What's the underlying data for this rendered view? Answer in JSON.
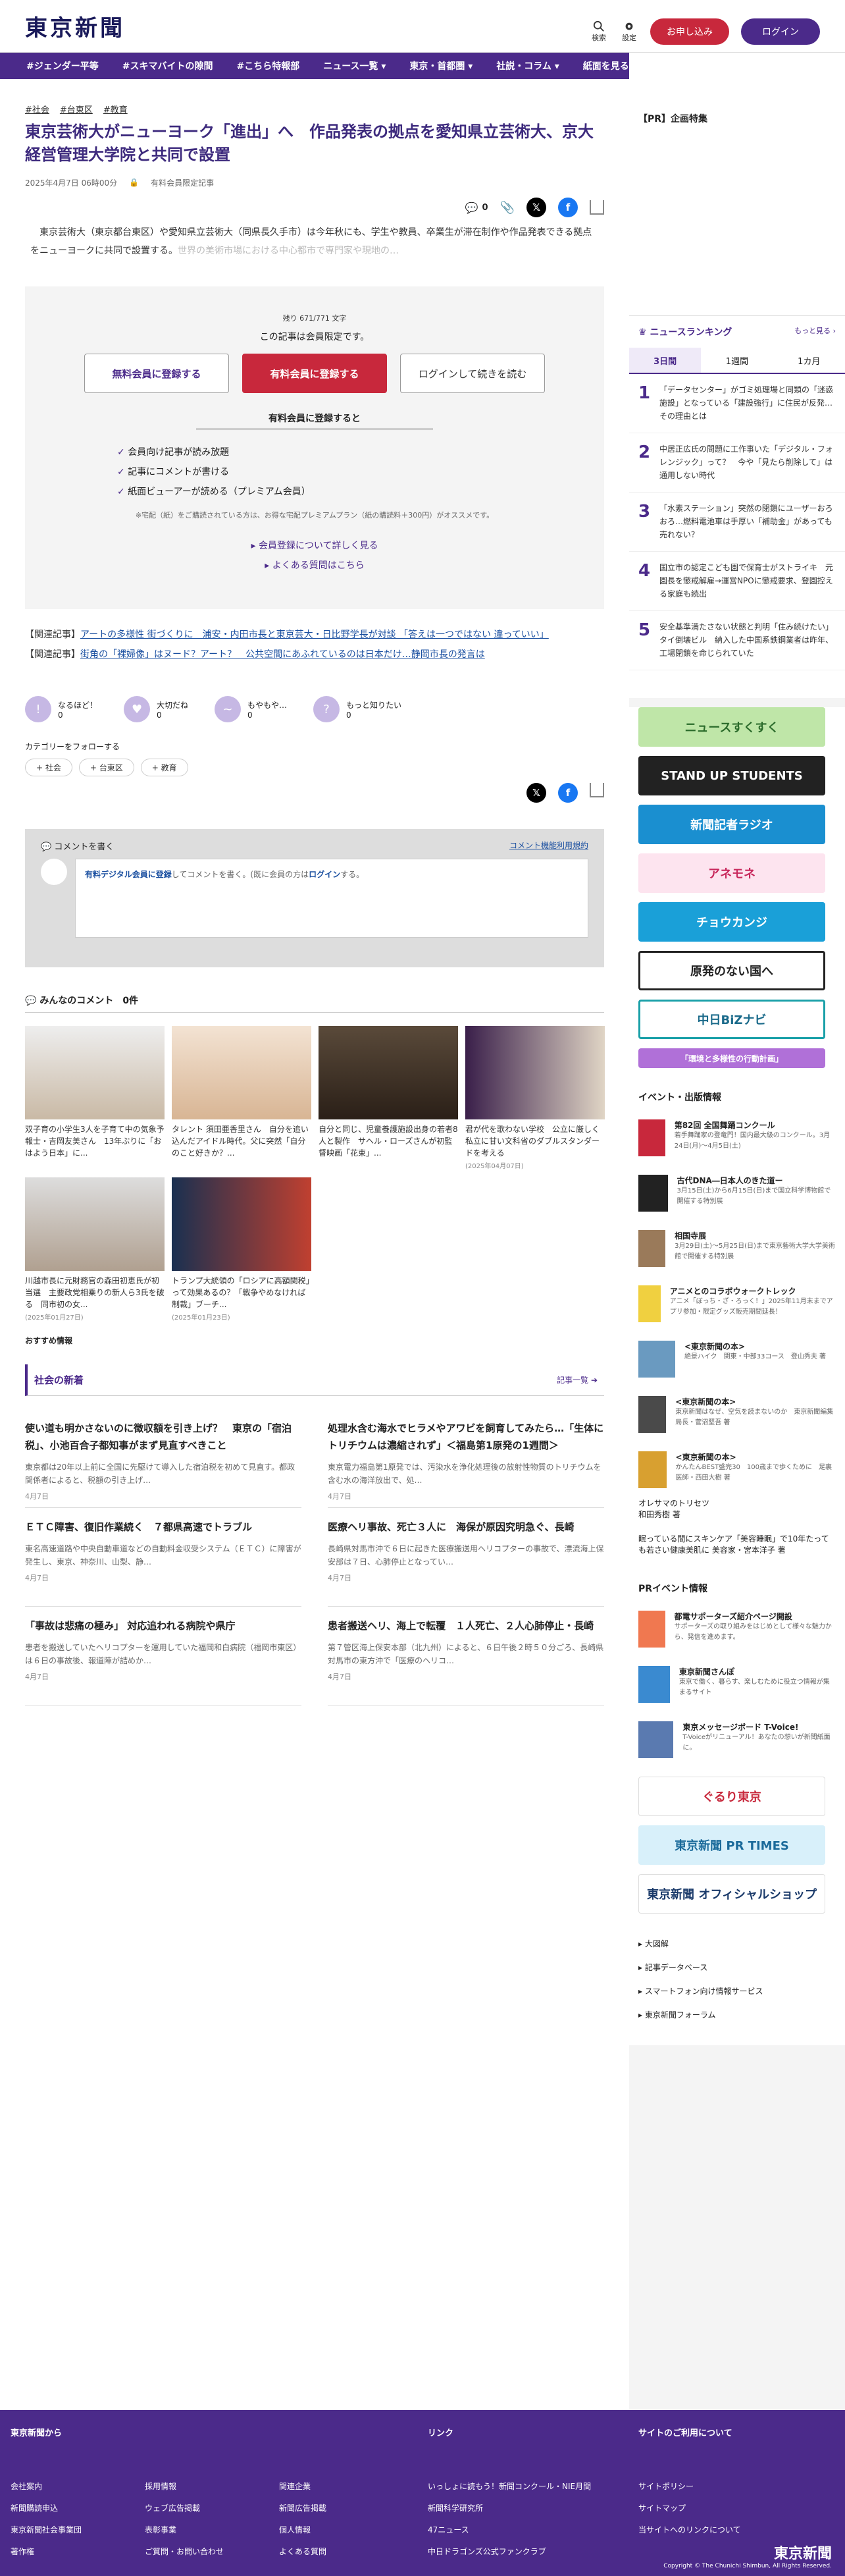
{
  "header": {
    "logo": "東京新聞",
    "search_label": "検索",
    "settings_label": "設定",
    "register_label": "お申し込み",
    "login_label": "ログイン"
  },
  "nav": [
    "#ジェンダー平等",
    "#スキマバイトの隙間",
    "#こちら特報部",
    "ニュース一覧 ▾",
    "東京・首都圏 ▾",
    "社説・コラム ▾",
    "紙面を見る ▾"
  ],
  "article": {
    "tags": [
      "#社会",
      "#台東区",
      "#教育"
    ],
    "title": "東京芸術大がニューヨーク「進出」へ　作品発表の拠点を愛知県立芸術大、京大経営管理大学院と共同で設置",
    "date": "2025年4月7日 06時00分",
    "member_only": "有料会員限定記事",
    "comment_count": "0",
    "lead": "　東京芸術大（東京都台東区）や愛知県立芸術大（同県長久手市）は今年秋にも、学生や教員、卒業生が滞在制作や作品発表できる拠点をニューヨークに共同で設置する。",
    "lead_fade": "世界の美術市場における中心都市で専門家や現地の…"
  },
  "paywall": {
    "remaining": "残り 671/771 文字",
    "notice": "この記事は会員限定です。",
    "btn_free": "無料会員に登録する",
    "btn_paid": "有料会員に登録する",
    "btn_login": "ログインして続きを読む",
    "benefit_title": "有料会員に登録すると",
    "benefits": [
      "会員向け記事が読み放題",
      "記事にコメントが書ける",
      "紙面ビューアーが読める（プレミアム会員）"
    ],
    "note": "※宅配（紙）をご購読されている方は、お得な宅配プレミアムプラン（紙の購読料＋300円）がオススメです。",
    "more": "会員登録について詳しく見る",
    "faq": "よくある質問はこちら"
  },
  "related": [
    {
      "label": "【関連記事】",
      "text": "アートの多様性 街づくりに　浦安・内田市長と東京芸大・日比野学長が対談 「答えは一つではない 違っていい」"
    },
    {
      "label": "【関連記事】",
      "text": "街角の「裸婦像」はヌード？アート？　公共空間にあふれているのは日本だけ…静岡市長の発言は"
    }
  ],
  "reactions": [
    {
      "label": "なるほど！",
      "count": "0"
    },
    {
      "label": "大切だね",
      "count": "0"
    },
    {
      "label": "もやもや…",
      "count": "0"
    },
    {
      "label": "もっと知りたい",
      "count": "0"
    }
  ],
  "follow": {
    "title": "カテゴリーをフォローする",
    "chips": [
      "+ 社会",
      "+ 台東区",
      "+ 教育"
    ]
  },
  "comment": {
    "write": "コメントを書く",
    "rules": "コメント機能利用規約",
    "placeholder_link": "有料デジタル会員に登録",
    "placeholder_rest": "してコメントを書く。(既に会員の方は",
    "placeholder_login": "ログイン",
    "placeholder_end": "する。",
    "all_title": "みんなのコメント",
    "all_count": "0件"
  },
  "thumbs": [
    {
      "cap": "双子育の小学生3人を子育て中の気象予報士・吉岡友美さん　13年ぶりに「おはよう日本」に...",
      "date": ""
    },
    {
      "cap": "タレント 須田亜香里さん　自分を追い込んだアイドル時代。父に突然「自分のこと好きか？...",
      "date": ""
    },
    {
      "cap": "自分と同じ、児童養護施設出身の若者8人と製作　サヘル・ローズさんが初監督映画「花束」...",
      "date": ""
    },
    {
      "cap": "君が代を歌わない学校　公立に厳しく私立に甘い文科省のダブルスタンダードを考える",
      "date": "(2025年04月07日)"
    },
    {
      "cap": "川越市長に元財務官の森田初恵氏が初当選　主要政党相乗りの新人ら3氏を破る　同市初の女...",
      "date": "(2025年01月27日)"
    },
    {
      "cap": "トランプ大統領の「ロシアに高額関税」って効果あるの？「戦争やめなければ制裁」ブーチ...",
      "date": "(2025年01月23日)"
    }
  ],
  "recommend": "おすすめ情報",
  "social": {
    "title": "社会の新着",
    "more": "記事一覧",
    "items": [
      {
        "t": "使い道も明かさないのに徴収額を引き上げ？　東京の「宿泊税」、小池百合子都知事がまず見直すべきこと",
        "b": "東京都は20年以上前に全国に先駆けて導入した宿泊税を初めて見直す。都政関係者によると、税額の引き上げ…",
        "d": "4月7日"
      },
      {
        "t": "処理水含む海水でヒラメやアワビを飼育してみたら…「生体にトリチウムは濃縮されず」＜福島第1原発の1週間＞",
        "b": "東京電力福島第1原発では、汚染水を浄化処理後の放射性物質のトリチウムを含む水の海洋放出で、処…",
        "d": "4月7日"
      },
      {
        "t": "ＥＴＣ障害、復旧作業続く　７都県高速でトラブル",
        "b": "東名高速道路や中央自動車道などの自動料金収受システム（ＥＴＣ）に障害が発生し、東京、神奈川、山梨、静…",
        "d": "4月7日"
      },
      {
        "t": "医療ヘリ事故、死亡３人に　海保が原因究明急ぐ、長崎",
        "b": "長崎県対馬市沖で６日に起きた医療搬送用ヘリコプターの事故で、漂流海上保安部は７日、心肺停止となってい…",
        "d": "4月7日"
      },
      {
        "t": "「事故は悲痛の極み」 対応追われる病院や県庁",
        "b": "患者を搬送していたヘリコプターを運用していた福岡和白病院（福岡市東区）は６日の事故後、報道陣が詰めか…",
        "d": "4月7日"
      },
      {
        "t": "患者搬送ヘリ、海上で転覆　１人死亡、２人心肺停止・長崎",
        "b": "第７管区海上保安本部（北九州）によると、６日午後２時５０分ごろ、長崎県対馬市の東方沖で「医療のヘリコ…",
        "d": "4月7日"
      }
    ]
  },
  "sidebar": {
    "pr": "【PR】企画特集",
    "ranking_title": "ニュースランキング",
    "ranking_more": "もっと見る",
    "tabs": [
      "3日間",
      "1週間",
      "1カ月"
    ],
    "ranking": [
      "「データセンター」がゴミ処理場と同類の「迷惑施設」となっている「建設強行」に住民が反発…その理由とは",
      "中居正広氏の問題に工作事いた「デジタル・フォレンジック」って？　今や「見たら削除して」は通用しない時代",
      "「水素ステーション」突然の閉鎖にユーザーおろおろ…燃料電池車は手厚い「補助金」があっても売れない？",
      "国立市の認定こども園で保育士がストライキ　元園長を懲戒解雇→運営NPOに懲戒要求、登園控える家庭も続出",
      "安全基準満たさない状態と判明「住み続けたい」　タイ倒壊ビル　納入した中国系鉄鋼業者は昨年、工場閉鎖を命じられていた"
    ],
    "banners": [
      "ニュースすくすく",
      "STAND UP STUDENTS",
      "新聞記者ラジオ",
      "アネモネ",
      "チョウカンジ",
      "原発のない国へ",
      "中日BiZナビ",
      "「環境と多様性の行動計画」"
    ],
    "events_title": "イベント・出版情報",
    "events": [
      {
        "t": "第82回 全国舞踊コンクール",
        "s": "若手舞踊家の登竜門！国内最大級のコンクール。3月24日(月)～4月5日(土)"
      },
      {
        "t": "古代DNA―日本人のきた道ー",
        "s": "3月15日(土)から6月15日(日)まで国立科学博物館で開催する特別展"
      },
      {
        "t": "相国寺展",
        "s": "3月29日(土)～5月25日(日)まで東京藝術大学大学美術館で開催する特別展"
      },
      {
        "t": "アニメとのコラボウォークトレック",
        "s": "アニメ「ぼっち・ざ・ろっく！」2025年11月末までアプリ参加・限定グッズ販売期間延長！"
      },
      {
        "t": "<東京新聞の本>",
        "s": "絶景ハイク　関東・中部33コース　登山秀夫 著"
      },
      {
        "t": "<東京新聞の本>",
        "s": "東京新聞はなぜ、空気を読まないのか　東京新聞編集局長・菅沼堅吾 著"
      },
      {
        "t": "<東京新聞の本>",
        "s": "かんたんBEST盛完30　100歳まで歩くために　足裏医師・西田大樹 著"
      }
    ],
    "extra1_t": "オレサマのトリセツ",
    "extra1_s": "和田秀樹 著",
    "extra2": "眠っている間にスキンケア「美容睡眠」で10年たっても若さい健康美肌に 美容家・宮本洋子 著",
    "pr_title": "PRイベント情報",
    "pr_items": [
      {
        "t": "都電サポーターズ紹介ページ開設",
        "s": "サポーターズの取り組みをはじめとして様々な魅力から、発信を進めます。"
      },
      {
        "t": "東京新聞さんぽ",
        "s": "東京で働く、暮らす、楽しむために役立つ情報が集まるサイト"
      },
      {
        "t": "東京メッセージボード T-Voice!",
        "s": "T-Voiceがリニューアル！あなたの想いが新聞紙面に。"
      }
    ],
    "shop_banners": [
      "ぐるり東京",
      "東京新聞 PR TIMES",
      "東京新聞 オフィシャルショップ"
    ],
    "links": [
      "大図解",
      "記事データベース",
      "スマートフォン向け情報サービス",
      "東京新聞フォーラム"
    ]
  },
  "footer": {
    "col1": "東京新聞から",
    "col1a": [
      "会社案内",
      "新聞購読申込",
      "東京新聞社会事業団",
      "著作権"
    ],
    "col1b": [
      "採用情報",
      "ウェブ広告掲載",
      "表彰事業",
      "ご質問・お問い合わせ"
    ],
    "col1c": [
      "関連企業",
      "新聞広告掲載",
      "個人情報",
      "よくある質問"
    ],
    "col2": "リンク",
    "col2a": [
      "いっしょに読もう！新聞コンクール・NIE月間",
      "新聞科学研究所",
      "47ニュース",
      "中日ドラゴンズ公式ファンクラブ"
    ],
    "col3": "サイトのご利用について",
    "col3a": [
      "サイトポリシー",
      "サイトマップ",
      "当サイトへのリンクについて"
    ],
    "logo": "東京新聞",
    "copy": "Copyright © The Chunichi Shimbun, All Rights Reserved."
  }
}
